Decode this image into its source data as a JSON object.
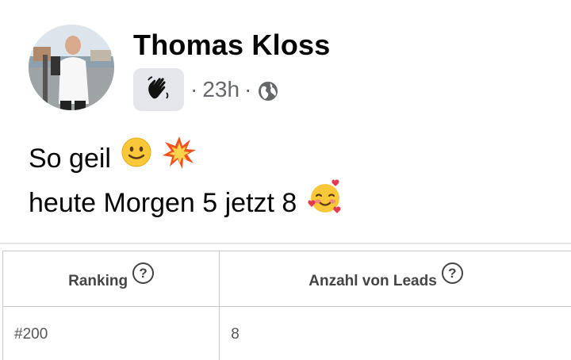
{
  "post": {
    "author": "Thomas Kloss",
    "timestamp": "23h",
    "separator": "·",
    "audience_icon": "globe-icon",
    "badge_icon": "waving-hand-icon",
    "lines": [
      {
        "text": "So geil",
        "emojis": [
          "🙂",
          "💥"
        ]
      },
      {
        "text": "heute Morgen 5 jetzt 8",
        "emojis": [
          "🥰"
        ]
      }
    ]
  },
  "table": {
    "headers": [
      "Ranking",
      "Anzahl von Leads"
    ],
    "help_symbol": "?",
    "rows": [
      [
        "#200",
        "8"
      ]
    ]
  }
}
